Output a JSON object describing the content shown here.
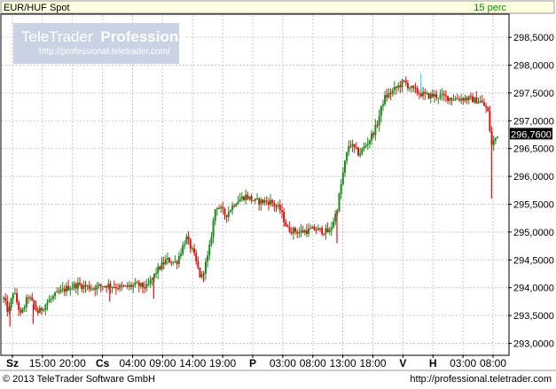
{
  "header": {
    "instrument": "EUR/HUF Spot",
    "interval": "15 perc"
  },
  "watermark": {
    "brand_plain": "TeleTrader",
    "brand_bold": "Professional",
    "url": "http://professional.teletrader.com/"
  },
  "footer": {
    "copyright": "© 2013 TeleTrader Software GmbH",
    "url": "http://professional.teletrader.com"
  },
  "colors": {
    "up": "#1a8a1a",
    "down": "#dd1111",
    "header_bg": "#ffffe0",
    "price_tag_bg": "#000000",
    "price_tag_fg": "#ffffff",
    "grid": "#c8c8c8"
  },
  "chart_data": {
    "type": "candlestick",
    "title": "EUR/HUF Spot",
    "interval": "15 perc",
    "ylim": [
      292.8,
      298.9
    ],
    "y_ticks": [
      "293,0000",
      "293,5000",
      "294,0000",
      "294,5000",
      "295,0000",
      "295,5000",
      "296,0000",
      "296,5000",
      "297,0000",
      "297,5000",
      "298,0000",
      "298,5000"
    ],
    "y_tick_values": [
      293.0,
      293.5,
      294.0,
      294.5,
      295.0,
      295.5,
      296.0,
      296.5,
      297.0,
      297.5,
      298.0,
      298.5
    ],
    "x_ticks": [
      {
        "label": "Sz",
        "bold": true
      },
      {
        "label": "15:00",
        "bold": false
      },
      {
        "label": "20:00",
        "bold": false
      },
      {
        "label": "Cs",
        "bold": true
      },
      {
        "label": "04:00",
        "bold": false
      },
      {
        "label": "09:00",
        "bold": false
      },
      {
        "label": "14:00",
        "bold": false
      },
      {
        "label": "19:00",
        "bold": false
      },
      {
        "label": "P",
        "bold": true
      },
      {
        "label": "03:00",
        "bold": false
      },
      {
        "label": "08:00",
        "bold": false
      },
      {
        "label": "13:00",
        "bold": false
      },
      {
        "label": "18:00",
        "bold": false
      },
      {
        "label": "V",
        "bold": true
      },
      {
        "label": "H",
        "bold": true
      },
      {
        "label": "03:00",
        "bold": false
      },
      {
        "label": "08:00",
        "bold": false
      }
    ],
    "last_price": 296.76,
    "last_price_label": "296,7600",
    "price_path": [
      {
        "x": 0.0,
        "y": 293.8
      },
      {
        "x": 0.01,
        "y": 293.55
      },
      {
        "x": 0.02,
        "y": 293.95
      },
      {
        "x": 0.035,
        "y": 293.5
      },
      {
        "x": 0.05,
        "y": 293.85
      },
      {
        "x": 0.07,
        "y": 293.55
      },
      {
        "x": 0.09,
        "y": 293.75
      },
      {
        "x": 0.11,
        "y": 293.9
      },
      {
        "x": 0.13,
        "y": 294.0
      },
      {
        "x": 0.15,
        "y": 294.05
      },
      {
        "x": 0.18,
        "y": 294.0
      },
      {
        "x": 0.21,
        "y": 294.05
      },
      {
        "x": 0.24,
        "y": 294.0
      },
      {
        "x": 0.27,
        "y": 294.05
      },
      {
        "x": 0.29,
        "y": 294.0
      },
      {
        "x": 0.31,
        "y": 294.3
      },
      {
        "x": 0.33,
        "y": 294.5
      },
      {
        "x": 0.35,
        "y": 294.45
      },
      {
        "x": 0.37,
        "y": 294.9
      },
      {
        "x": 0.385,
        "y": 294.6
      },
      {
        "x": 0.4,
        "y": 294.15
      },
      {
        "x": 0.415,
        "y": 294.6
      },
      {
        "x": 0.43,
        "y": 295.5
      },
      {
        "x": 0.45,
        "y": 295.3
      },
      {
        "x": 0.47,
        "y": 295.55
      },
      {
        "x": 0.49,
        "y": 295.65
      },
      {
        "x": 0.51,
        "y": 295.55
      },
      {
        "x": 0.54,
        "y": 295.55
      },
      {
        "x": 0.56,
        "y": 295.4
      },
      {
        "x": 0.575,
        "y": 295.05
      },
      {
        "x": 0.6,
        "y": 295.0
      },
      {
        "x": 0.63,
        "y": 295.05
      },
      {
        "x": 0.66,
        "y": 295.0
      },
      {
        "x": 0.675,
        "y": 295.4
      },
      {
        "x": 0.69,
        "y": 296.2
      },
      {
        "x": 0.7,
        "y": 296.6
      },
      {
        "x": 0.72,
        "y": 296.4
      },
      {
        "x": 0.74,
        "y": 296.65
      },
      {
        "x": 0.755,
        "y": 296.9
      },
      {
        "x": 0.77,
        "y": 297.4
      },
      {
        "x": 0.79,
        "y": 297.55
      },
      {
        "x": 0.81,
        "y": 297.7
      },
      {
        "x": 0.83,
        "y": 297.55
      },
      {
        "x": 0.855,
        "y": 297.45
      },
      {
        "x": 0.88,
        "y": 297.45
      },
      {
        "x": 0.91,
        "y": 297.4
      },
      {
        "x": 0.94,
        "y": 297.4
      },
      {
        "x": 0.965,
        "y": 297.35
      },
      {
        "x": 0.98,
        "y": 297.2
      },
      {
        "x": 0.988,
        "y": 296.55
      },
      {
        "x": 1.0,
        "y": 296.76
      }
    ],
    "spikes": [
      {
        "x": 0.013,
        "low": 293.3
      },
      {
        "x": 0.06,
        "low": 293.35
      },
      {
        "x": 0.215,
        "low": 293.75
      },
      {
        "x": 0.304,
        "low": 293.8
      },
      {
        "x": 0.405,
        "low": 294.1
      },
      {
        "x": 0.675,
        "low": 294.8
      },
      {
        "x": 0.988,
        "low": 295.6
      }
    ],
    "gap_marker": {
      "x": 0.845,
      "high": 297.85,
      "low": 297.5
    }
  }
}
